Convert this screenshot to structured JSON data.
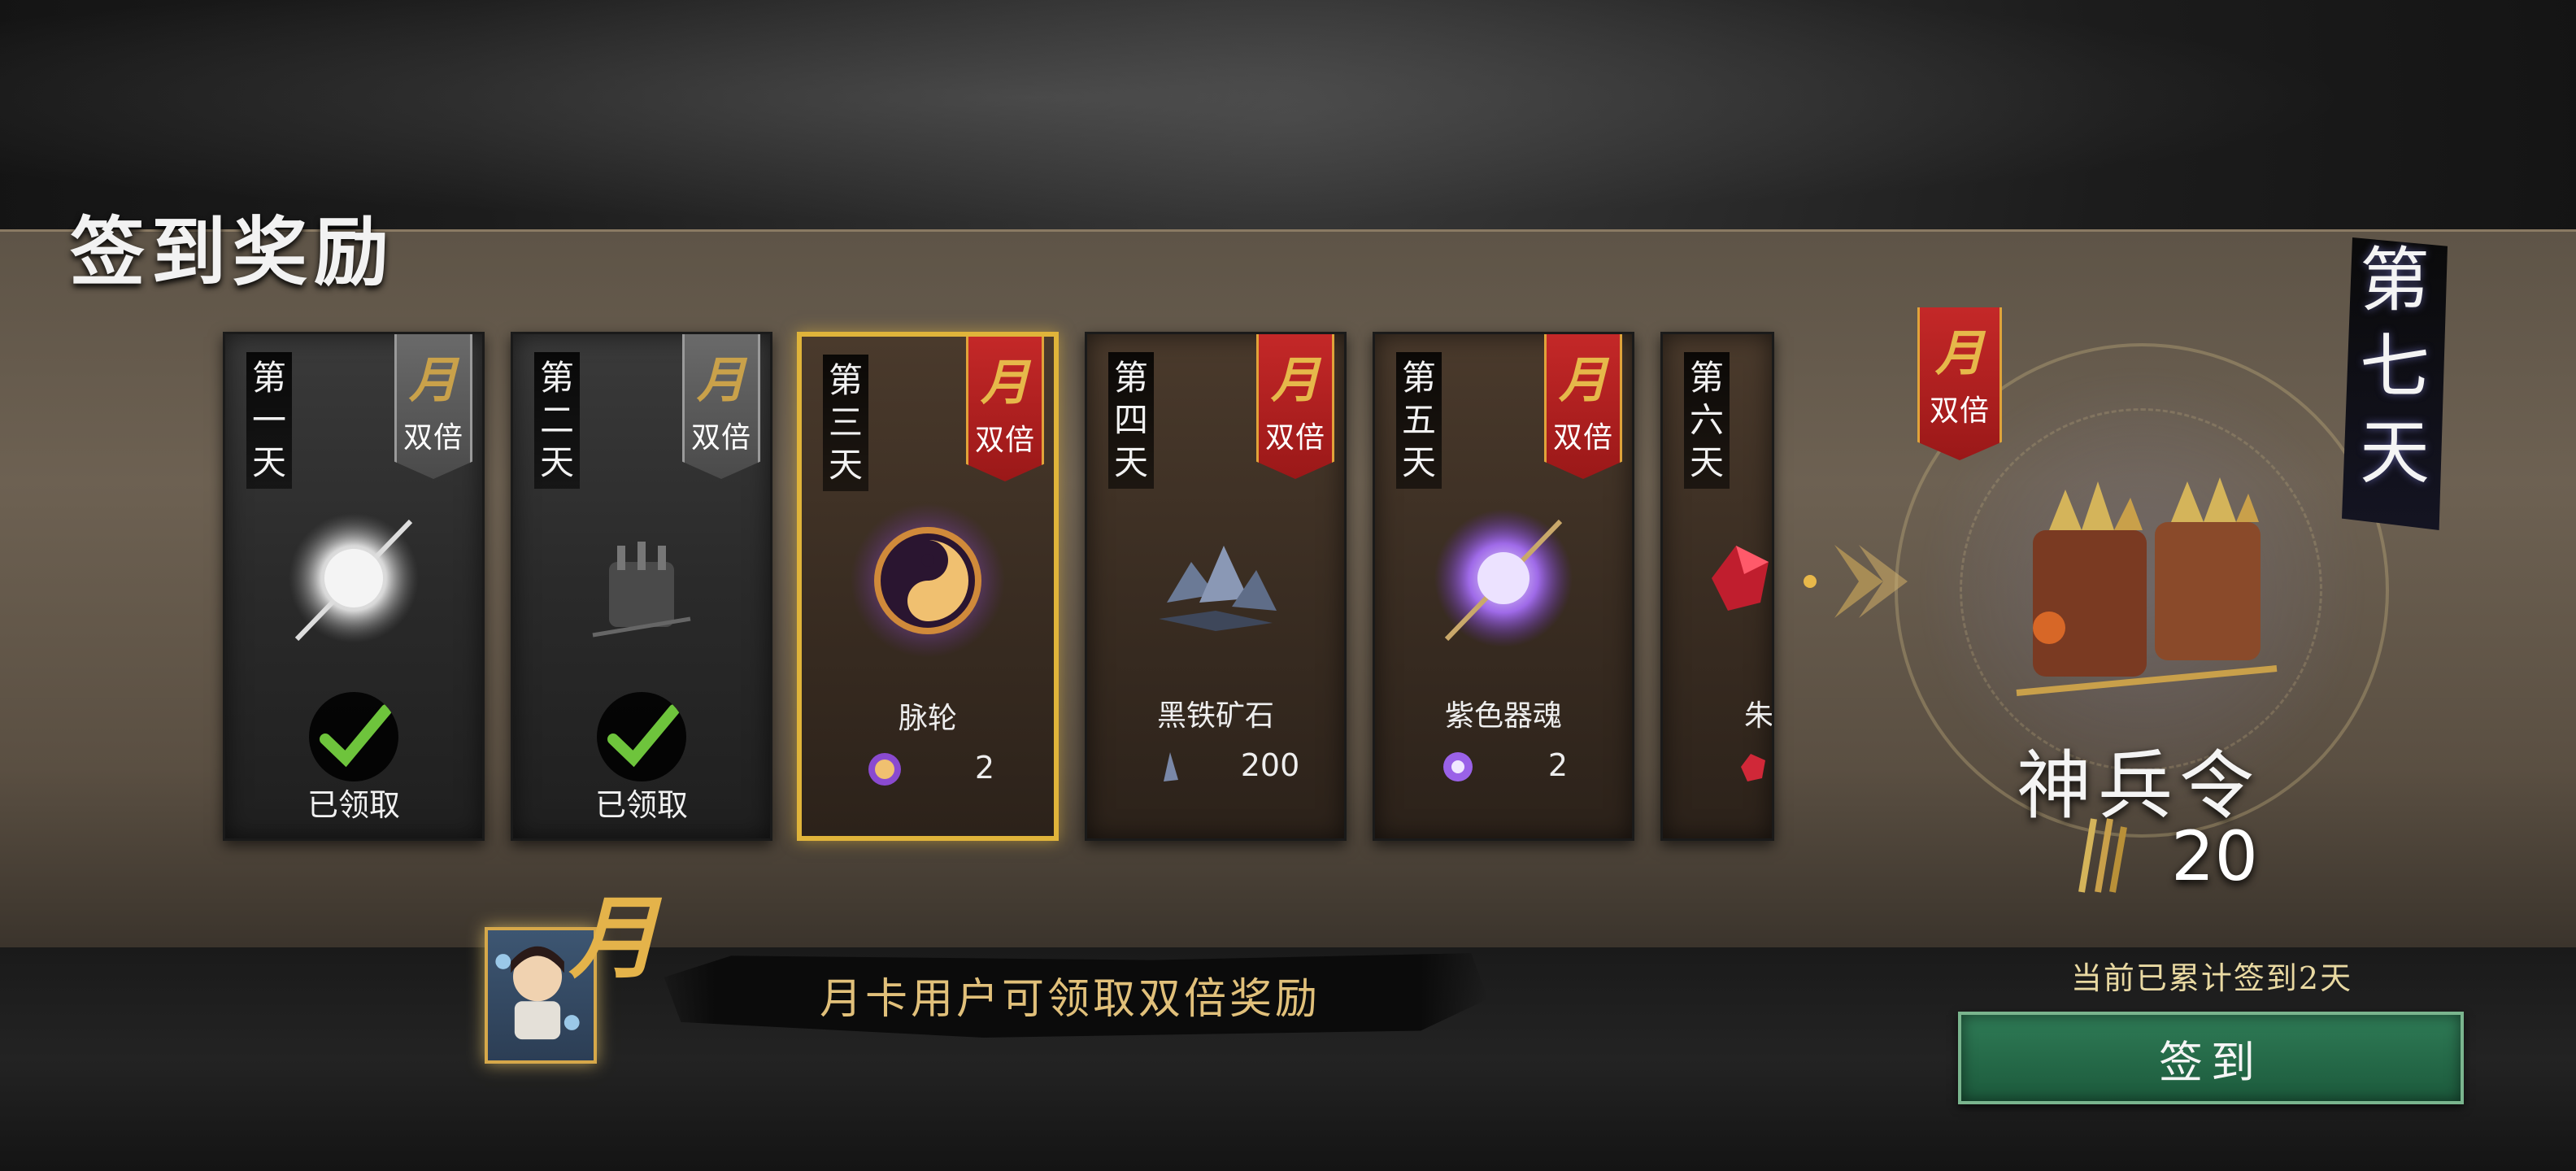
{
  "page": {
    "title": "签到奖励"
  },
  "days": [
    {
      "label": [
        "第",
        "一",
        "天"
      ],
      "ribbon_mark": "月",
      "ribbon_text": "双倍",
      "state": "claimed",
      "claimed_text": "已领取",
      "item_icon": "white-orb-icon"
    },
    {
      "label": [
        "第",
        "二",
        "天"
      ],
      "ribbon_mark": "月",
      "ribbon_text": "双倍",
      "state": "claimed",
      "claimed_text": "已领取",
      "item_icon": "token-bucket-icon"
    },
    {
      "label": [
        "第",
        "三",
        "天"
      ],
      "ribbon_mark": "月",
      "ribbon_text": "双倍",
      "state": "selected",
      "item_name": "脉轮",
      "qty": "2",
      "item_icon": "yin-yang-orb-icon"
    },
    {
      "label": [
        "第",
        "四",
        "天"
      ],
      "ribbon_mark": "月",
      "ribbon_text": "双倍",
      "state": "available",
      "item_name": "黑铁矿石",
      "qty": "200",
      "item_icon": "black-iron-ore-icon"
    },
    {
      "label": [
        "第",
        "五",
        "天"
      ],
      "ribbon_mark": "月",
      "ribbon_text": "双倍",
      "state": "available",
      "item_name": "紫色器魂",
      "qty": "2",
      "item_icon": "purple-orb-icon"
    },
    {
      "label": [
        "第",
        "六",
        "天"
      ],
      "state": "available",
      "item_name": "朱",
      "item_icon": "red-gem-icon"
    }
  ],
  "day7": {
    "label": [
      "第",
      "七",
      "天"
    ],
    "ribbon_mark": "月",
    "ribbon_text": "双倍",
    "reward_name": "神兵令",
    "qty": "20",
    "reward_icon": "divine-token-icon"
  },
  "monthly": {
    "card_mark": "月",
    "banner_text": "月卡用户可领取双倍奖励"
  },
  "progress": {
    "text": "当前已累计签到2天"
  },
  "sign_button": {
    "label": "签到"
  },
  "colors": {
    "accent_gold": "#e0b43a",
    "ribbon_red": "#c42828",
    "button_green": "#2f7b56",
    "check_green": "#6ec43c"
  }
}
